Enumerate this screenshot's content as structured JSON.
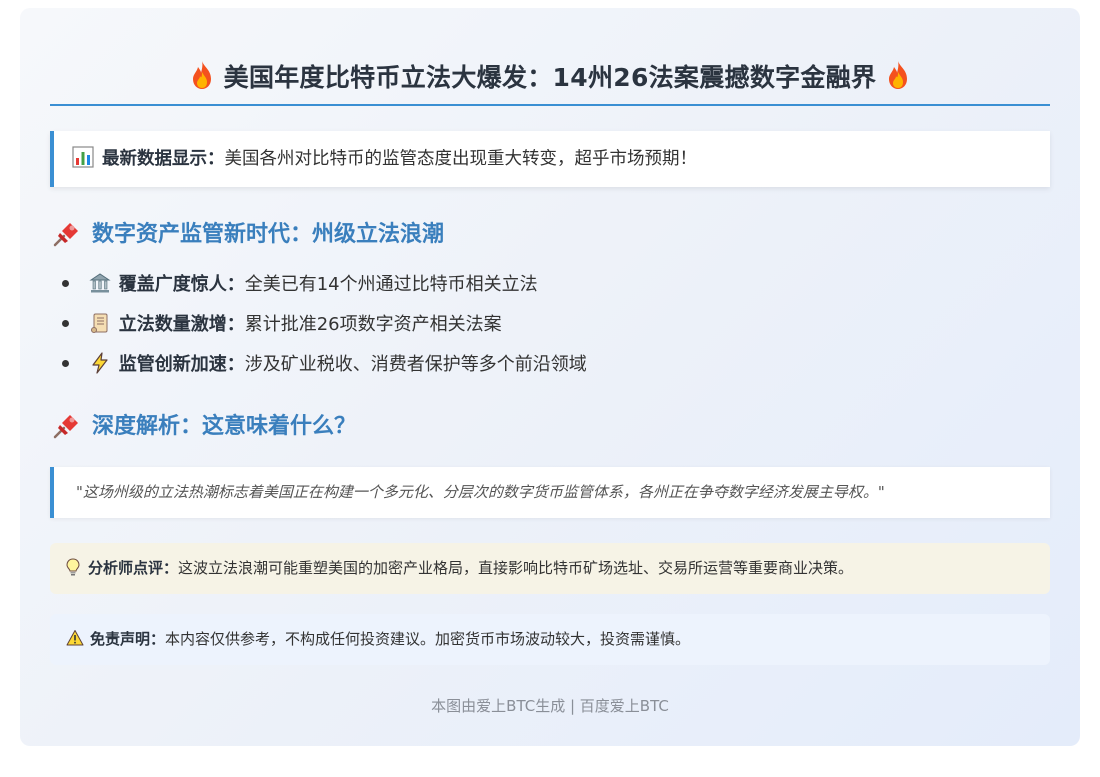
{
  "title": {
    "text": "美国年度比特币立法大爆发：14州26法案震撼数字金融界",
    "icon_left": "fire-icon",
    "icon_right": "fire-icon"
  },
  "highlight": {
    "icon": "bar-chart-icon",
    "label": "最新数据显示：",
    "text": "美国各州对比特币的监管态度出现重大转变，超乎市场预期！"
  },
  "section1": {
    "icon": "pushpin-icon",
    "heading": "数字资产监管新时代：州级立法浪潮"
  },
  "bullets": [
    {
      "icon": "bank-icon",
      "label": "覆盖广度惊人：",
      "text": "全美已有14个州通过比特币相关立法"
    },
    {
      "icon": "scroll-icon",
      "label": "立法数量激增：",
      "text": "累计批准26项数字资产相关法案"
    },
    {
      "icon": "lightning-icon",
      "label": "监管创新加速：",
      "text": "涉及矿业税收、消费者保护等多个前沿领域"
    }
  ],
  "section2": {
    "icon": "pushpin-icon",
    "heading": "深度解析：这意味着什么？"
  },
  "quote": {
    "text": "\"这场州级的立法热潮标志着美国正在构建一个多元化、分层次的数字货币监管体系，各州正在争夺数字经济发展主导权。\""
  },
  "analyst": {
    "icon": "lightbulb-icon",
    "label": "分析师点评：",
    "text": "这波立法浪潮可能重塑美国的加密产业格局，直接影响比特币矿场选址、交易所运营等重要商业决策。"
  },
  "disclaimer": {
    "icon": "warning-icon",
    "label": "免责声明：",
    "text": "本内容仅供参考，不构成任何投资建议。加密货币市场波动较大，投资需谨慎。"
  },
  "footer": {
    "text": "本图由爱上BTC生成 | 百度爱上BTC"
  },
  "colors": {
    "accent": "#3a8fd3",
    "heading": "#3a7fbd",
    "analyst_bg": "#f6f3e6",
    "disclaimer_bg": "#edf3fd"
  }
}
